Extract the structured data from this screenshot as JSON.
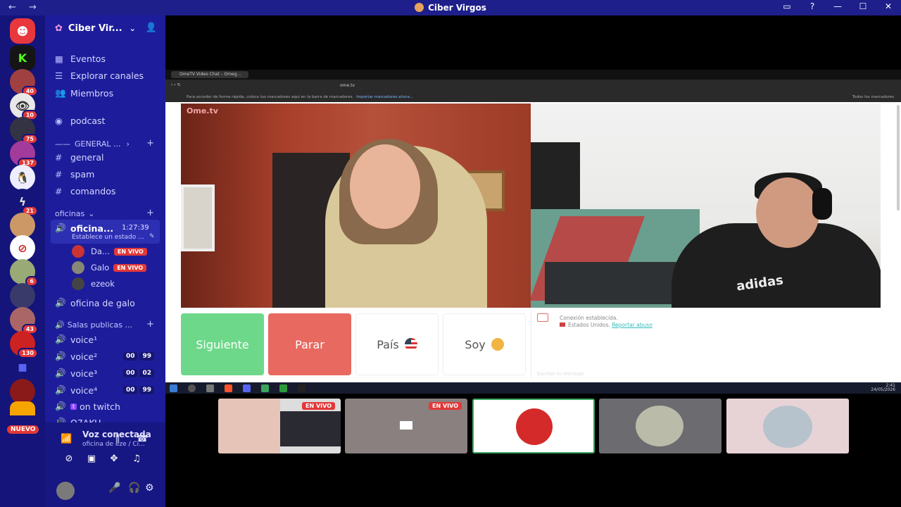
{
  "window": {
    "title": "Ciber Virgos",
    "nav_back": "←",
    "nav_forward": "→",
    "controls": [
      "▭",
      "?",
      "—",
      "☐",
      "✕"
    ]
  },
  "servers": [
    {
      "name": "discord-home",
      "badge": ""
    },
    {
      "name": "server-k",
      "badge": ""
    },
    {
      "name": "server-2",
      "badge": "40"
    },
    {
      "name": "server-3",
      "badge": "10"
    },
    {
      "name": "server-4",
      "badge": "75"
    },
    {
      "name": "server-5",
      "badge": "137"
    },
    {
      "name": "server-6",
      "badge": ""
    },
    {
      "name": "server-7",
      "badge": "21"
    },
    {
      "name": "server-8",
      "badge": ""
    },
    {
      "name": "server-9",
      "badge": ""
    },
    {
      "name": "server-10",
      "badge": "6"
    },
    {
      "name": "server-11",
      "badge": ""
    },
    {
      "name": "server-12",
      "badge": "43"
    },
    {
      "name": "server-13",
      "badge": "130"
    },
    {
      "name": "server-folder",
      "badge": ""
    },
    {
      "name": "server-15",
      "badge": ""
    }
  ],
  "nuevo": "NUEVO",
  "server_header": {
    "name": "Ciber Vir...",
    "chevron": "⌄"
  },
  "channels": {
    "eventos": "Eventos",
    "explorar": "Explorar canales",
    "miembros": "Miembros",
    "podcast": "podcast",
    "general_cat": "GENERAL ...",
    "general": "general",
    "spam": "spam",
    "comandos": "comandos",
    "oficinas_cat": "oficinas",
    "oficina_active": "oficina...",
    "oficina_timer": "1:27:39",
    "oficina_status": "Establece un estado ...",
    "users": [
      {
        "name": "Da...",
        "live": "EN VIVO"
      },
      {
        "name": "Galo",
        "live": "EN VIVO"
      },
      {
        "name": "ezeok",
        "live": ""
      }
    ],
    "oficina_galo": "oficina de galo",
    "salas_cat": "Salas publicas ...",
    "voices": [
      {
        "name": "voice¹",
        "c1": "",
        "c2": ""
      },
      {
        "name": "voice²",
        "c1": "00",
        "c2": "99"
      },
      {
        "name": "voice³",
        "c1": "00",
        "c2": "02"
      },
      {
        "name": "voice⁴",
        "c1": "00",
        "c2": "99"
      }
    ],
    "twitch": "on twitch",
    "otaku": "O7AKU"
  },
  "voice_panel": {
    "title": "Voz conectada",
    "subtitle": "oficina de eze / Ci..."
  },
  "browser": {
    "tab_title": "OmeTV Video Chat – Omeg...",
    "url": "ome.tv",
    "bookmark_text": "Para acceder de forma rápida, coloca tus marcadores aquí en la barra de marcadores.",
    "bookmark_link": "Importar marcadores ahora...",
    "bookmark_right": "Todos los marcadores"
  },
  "ometv": {
    "logo": "Ome.tv",
    "btn_next": "Siguiente",
    "btn_stop": "Parar",
    "btn_country": "País",
    "btn_me": "Soy",
    "chat_line1": "Conexión establecida.",
    "chat_line2": "Estados Unidos.",
    "chat_report": "Reportar abuso",
    "chat_placeholder": "Escribe tu mensaje",
    "brand_text": "adidas"
  },
  "taskbar": {
    "time": "2:41",
    "date": "24/05/2026"
  },
  "tiles": [
    {
      "name": "stream-tile-1",
      "live": "EN VIVO"
    },
    {
      "name": "stream-tile-2",
      "live": "EN VIVO"
    },
    {
      "name": "user-tile-3",
      "live": ""
    },
    {
      "name": "user-tile-4",
      "live": ""
    },
    {
      "name": "user-tile-5",
      "live": ""
    }
  ],
  "colors": {
    "server_rail": "#14147a",
    "channel_bg": "#1d1d9b",
    "live_red": "#e23838",
    "next_green": "#6dd88a",
    "stop_red": "#e8695f"
  }
}
